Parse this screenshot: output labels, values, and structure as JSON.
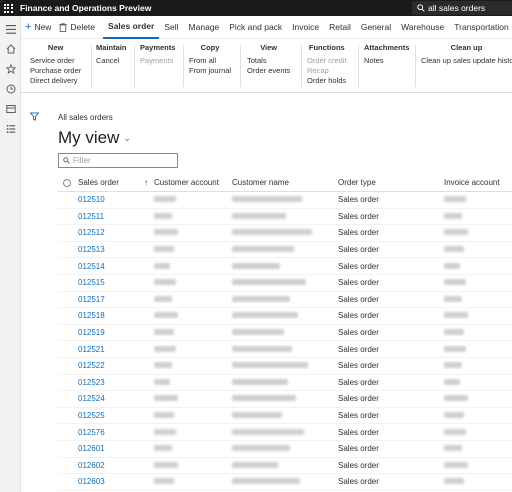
{
  "header": {
    "app_title": "Finance and Operations Preview",
    "search_text": "all sales orders"
  },
  "actions": {
    "new_label": "New",
    "delete_label": "Delete"
  },
  "tabs": [
    "Sales order",
    "Sell",
    "Manage",
    "Pick and pack",
    "Invoice",
    "Retail",
    "General",
    "Warehouse",
    "Transportation"
  ],
  "ribbon": {
    "new": {
      "title": "New",
      "items": [
        "Service order",
        "Purchase order",
        "Direct delivery"
      ]
    },
    "maintain": {
      "title": "Maintain",
      "items": [
        "Cancel"
      ]
    },
    "payments": {
      "title": "Payments",
      "items": [
        "Payments"
      ]
    },
    "copy": {
      "title": "Copy",
      "items": [
        "From all",
        "From journal"
      ]
    },
    "view": {
      "title": "View",
      "items": [
        "Totals",
        "Order events"
      ]
    },
    "functions": {
      "title": "Functions",
      "items": [
        "Order credit",
        "Recap",
        "Order holds"
      ]
    },
    "attachments": {
      "title": "Attachments",
      "items": [
        "Notes"
      ]
    },
    "cleanup": {
      "title": "Clean up",
      "items": [
        "Clean up sales update histo"
      ]
    }
  },
  "page": {
    "breadcrumb": "All sales orders",
    "view_title": "My view",
    "filter_placeholder": "Filter"
  },
  "grid": {
    "columns": [
      "Sales order",
      "Customer account",
      "Customer name",
      "Order type",
      "Invoice account"
    ],
    "rows": [
      {
        "sales_order": "012510",
        "order_type": "Sales order"
      },
      {
        "sales_order": "012511",
        "order_type": "Sales order"
      },
      {
        "sales_order": "012512",
        "order_type": "Sales order"
      },
      {
        "sales_order": "012513",
        "order_type": "Sales order"
      },
      {
        "sales_order": "012514",
        "order_type": "Sales order"
      },
      {
        "sales_order": "012515",
        "order_type": "Sales order"
      },
      {
        "sales_order": "012517",
        "order_type": "Sales order"
      },
      {
        "sales_order": "012518",
        "order_type": "Sales order"
      },
      {
        "sales_order": "012519",
        "order_type": "Sales order"
      },
      {
        "sales_order": "012521",
        "order_type": "Sales order"
      },
      {
        "sales_order": "012522",
        "order_type": "Sales order"
      },
      {
        "sales_order": "012523",
        "order_type": "Sales order"
      },
      {
        "sales_order": "012524",
        "order_type": "Sales order"
      },
      {
        "sales_order": "012525",
        "order_type": "Sales order"
      },
      {
        "sales_order": "012576",
        "order_type": "Sales order"
      },
      {
        "sales_order": "012601",
        "order_type": "Sales order"
      },
      {
        "sales_order": "012602",
        "order_type": "Sales order"
      },
      {
        "sales_order": "012603",
        "order_type": "Sales order"
      }
    ]
  },
  "colors": {
    "accent": "#0f6cbd",
    "header_bg": "#1a1a1a",
    "rail_bg": "#f3f2f1"
  },
  "icons": [
    "waffle-icon",
    "search-icon",
    "hamburger-icon",
    "home-icon",
    "star-icon",
    "recent-icon",
    "workspace-icon",
    "modules-icon",
    "plus-icon",
    "trash-icon",
    "filter-icon",
    "chevron-down-icon",
    "sort-arrow-icon"
  ]
}
